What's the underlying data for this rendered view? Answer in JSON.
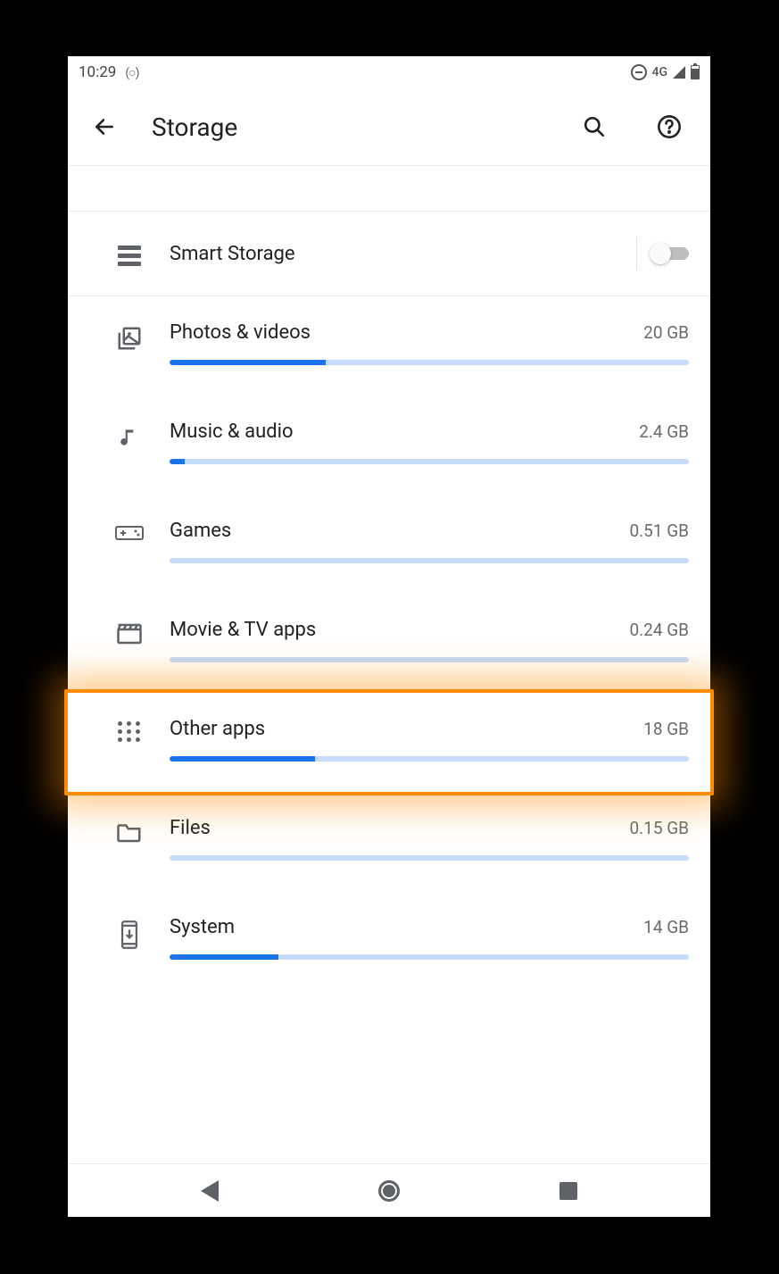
{
  "status": {
    "time": "10:29",
    "network_label": "4G"
  },
  "appbar": {
    "title": "Storage"
  },
  "smart_storage": {
    "label": "Smart Storage",
    "enabled": false
  },
  "categories": [
    {
      "id": "photos",
      "label": "Photos & videos",
      "value": "20 GB",
      "fill": 30
    },
    {
      "id": "music",
      "label": "Music & audio",
      "value": "2.4 GB",
      "fill": 3
    },
    {
      "id": "games",
      "label": "Games",
      "value": "0.51 GB",
      "fill": 0
    },
    {
      "id": "movietv",
      "label": "Movie & TV apps",
      "value": "0.24 GB",
      "fill": 0
    },
    {
      "id": "other",
      "label": "Other apps",
      "value": "18 GB",
      "fill": 28
    },
    {
      "id": "files",
      "label": "Files",
      "value": "0.15 GB",
      "fill": 0
    },
    {
      "id": "system",
      "label": "System",
      "value": "14 GB",
      "fill": 21
    }
  ],
  "highlighted_category_id": "other"
}
